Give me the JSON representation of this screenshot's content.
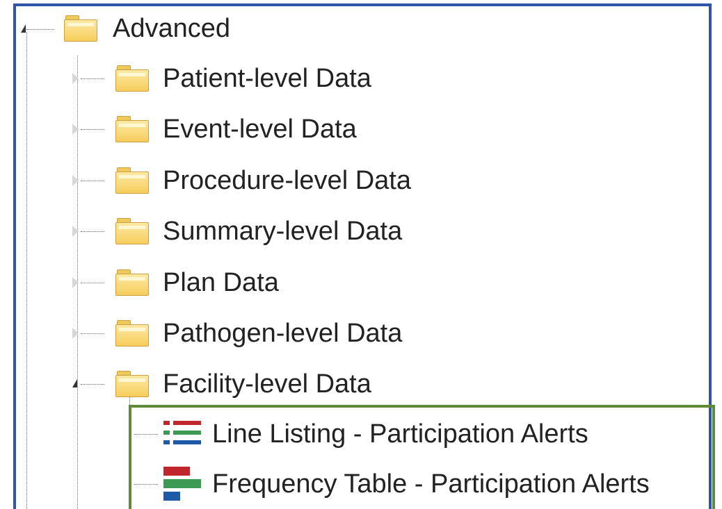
{
  "tree": {
    "root": {
      "label": "Advanced",
      "expander": "expanded",
      "icon": "folder-icon"
    },
    "children": [
      {
        "label": "Patient-level Data",
        "expander": "collapsed",
        "icon": "folder-icon"
      },
      {
        "label": "Event-level Data",
        "expander": "collapsed",
        "icon": "folder-icon"
      },
      {
        "label": "Procedure-level Data",
        "expander": "collapsed",
        "icon": "folder-icon"
      },
      {
        "label": "Summary-level Data",
        "expander": "collapsed",
        "icon": "folder-icon"
      },
      {
        "label": "Plan Data",
        "expander": "collapsed",
        "icon": "folder-icon"
      },
      {
        "label": "Pathogen-level Data",
        "expander": "collapsed",
        "icon": "folder-icon"
      },
      {
        "label": "Facility-level Data",
        "expander": "expanded",
        "icon": "folder-icon"
      }
    ],
    "facility_reports": [
      {
        "label": "Line Listing - Participation Alerts",
        "icon": "line-listing-icon"
      },
      {
        "label": "Frequency Table - Participation Alerts",
        "icon": "frequency-table-icon"
      }
    ]
  },
  "colors": {
    "frame_border": "#2f55a8",
    "highlight_border": "#5e8a3a",
    "folder_fill": "#f6cd5c",
    "icon_red": "#c0262c",
    "icon_green": "#3c9a53",
    "icon_blue": "#1f5aa6"
  }
}
